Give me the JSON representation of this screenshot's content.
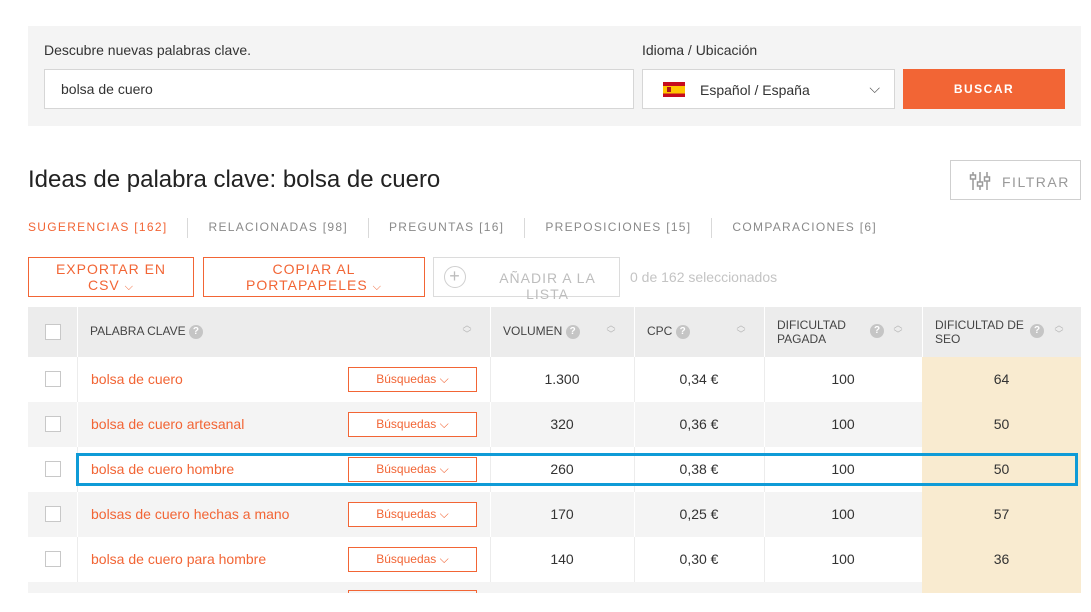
{
  "search": {
    "keyword_label": "Descubre nuevas palabras clave.",
    "keyword_value": "bolsa de cuero",
    "lang_label": "Idioma / Ubicación",
    "lang_value": "Español / España",
    "button_label": "BUSCAR"
  },
  "page_title": "Ideas de palabra clave: bolsa de cuero",
  "filter_label": "FILTRAR",
  "tabs": [
    {
      "label": "SUGERENCIAS [162]"
    },
    {
      "label": "RELACIONADAS [98]"
    },
    {
      "label": "PREGUNTAS [16]"
    },
    {
      "label": "PREPOSICIONES [15]"
    },
    {
      "label": "COMPARACIONES [6]"
    }
  ],
  "actions": {
    "export_label": "EXPORTAR EN CSV",
    "copy_label": "COPIAR AL PORTAPAPELES",
    "add_label": "AÑADIR A LA LISTA",
    "selected_text": "0 de 162 seleccionados"
  },
  "table": {
    "headers": {
      "keyword": "PALABRA CLAVE",
      "volume": "VOLUMEN",
      "cpc": "CPC",
      "paid_difficulty_1": "DIFICULTAD",
      "paid_difficulty_2": "PAGADA",
      "seo_difficulty_1": "DIFICULTAD DE",
      "seo_difficulty_2": "SEO"
    },
    "searches_button": "Búsquedas",
    "rows": [
      {
        "keyword": "bolsa de cuero",
        "volume": "1.300",
        "cpc": "0,34 €",
        "paid": "100",
        "seo": "64"
      },
      {
        "keyword": "bolsa de cuero artesanal",
        "volume": "320",
        "cpc": "0,36 €",
        "paid": "100",
        "seo": "50"
      },
      {
        "keyword": "bolsa de cuero hombre",
        "volume": "260",
        "cpc": "0,38 €",
        "paid": "100",
        "seo": "50"
      },
      {
        "keyword": "bolsas de cuero hechas a mano",
        "volume": "170",
        "cpc": "0,25 €",
        "paid": "100",
        "seo": "57"
      },
      {
        "keyword": "bolsa de cuero para hombre",
        "volume": "140",
        "cpc": "0,30 €",
        "paid": "100",
        "seo": "36"
      }
    ]
  },
  "colors": {
    "accent": "#f26535",
    "highlight": "#0f9bd7",
    "seo_bg": "#f9ebd0"
  },
  "icons": [
    "flag-spain-icon",
    "chevron-down-icon",
    "sliders-icon",
    "plus-circle-icon",
    "question-icon",
    "sort-icon"
  ]
}
